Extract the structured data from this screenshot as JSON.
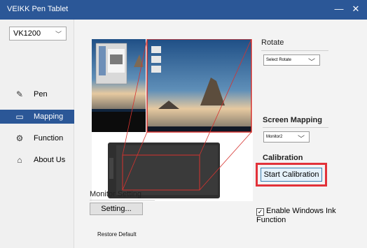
{
  "titlebar": {
    "title": "VEIKK Pen Tablet",
    "minimize_glyph": "—",
    "close_glyph": "✕"
  },
  "sidebar": {
    "device": "VK1200",
    "items": [
      {
        "label": "Pen",
        "icon": "pen-icon",
        "glyph": "✎",
        "active": false
      },
      {
        "label": "Mapping",
        "icon": "mapping-icon",
        "glyph": "▭",
        "active": true
      },
      {
        "label": "Function",
        "icon": "function-icon",
        "glyph": "⚙",
        "active": false
      },
      {
        "label": "About Us",
        "icon": "home-icon",
        "glyph": "⌂",
        "active": false
      }
    ]
  },
  "main": {
    "rotate": {
      "heading": "Rotate",
      "select_value": "Select Rotate"
    },
    "screen_mapping": {
      "heading": "Screen Mapping",
      "select_value": "Monitor2"
    },
    "calibration": {
      "heading": "Calibration",
      "button_label": "Start Calibration"
    },
    "ink": {
      "label": "Enable Windows Ink Function",
      "checked": true,
      "check_glyph": "✓"
    },
    "monitor_setting": {
      "heading": "Monitor Setting",
      "button_label": "Setting..."
    },
    "restore_label": "Restore Default"
  },
  "colors": {
    "accent": "#2b5797",
    "highlight": "#e2323a"
  }
}
